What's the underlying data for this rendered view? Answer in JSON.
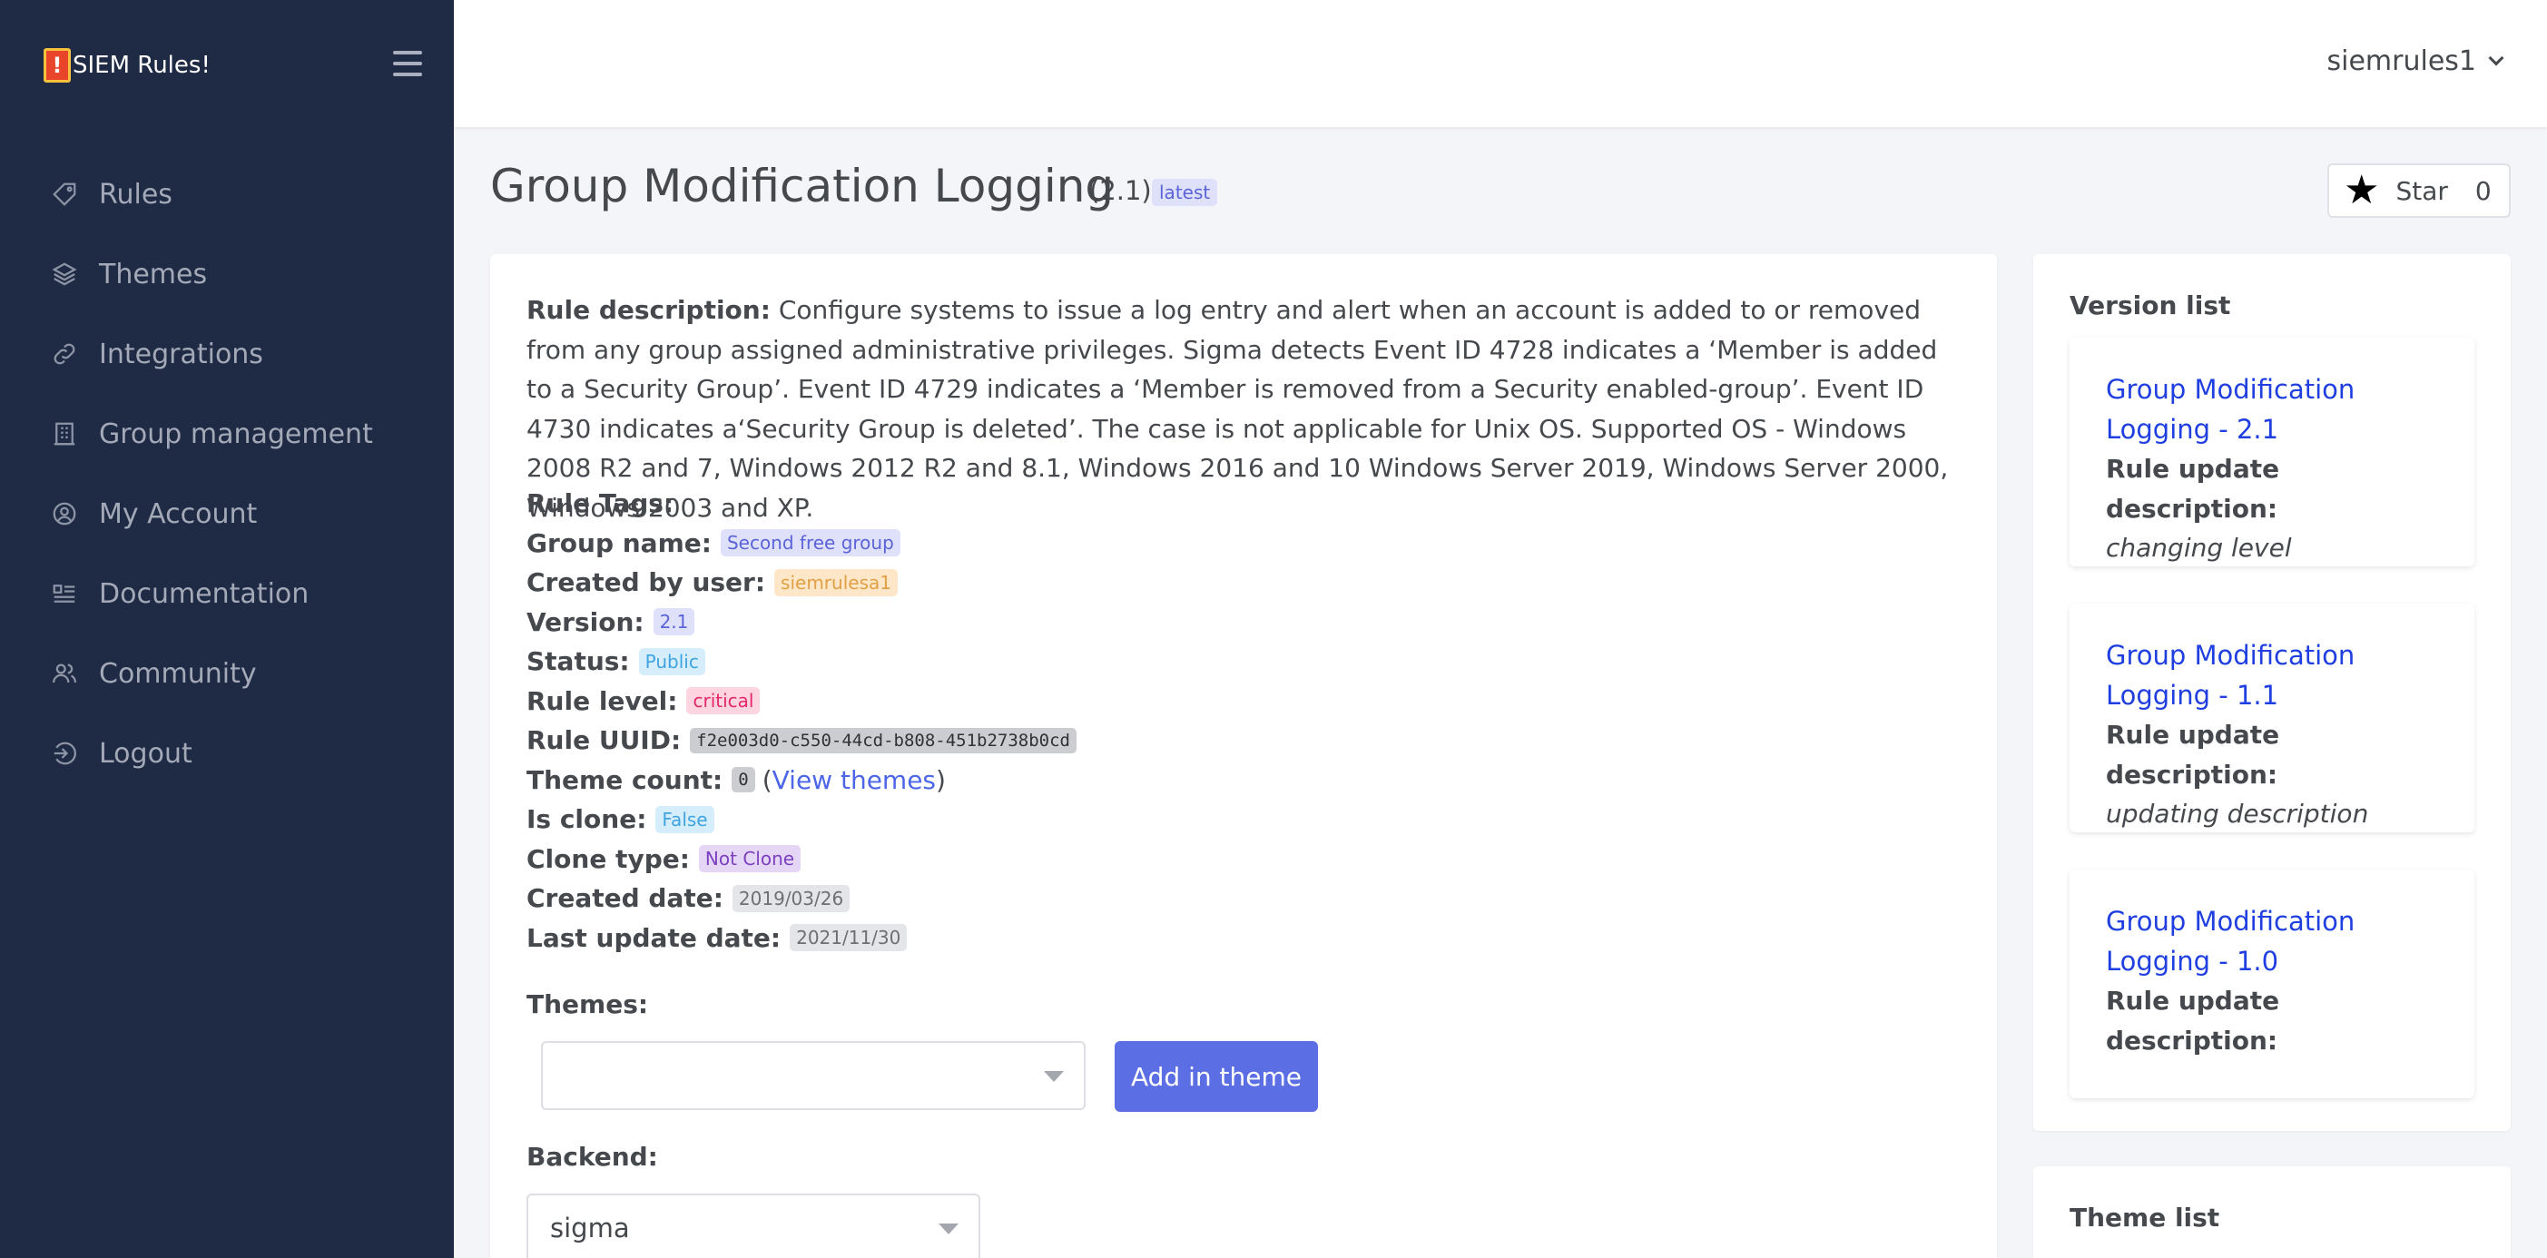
{
  "app": {
    "name": "SIEM Rules!"
  },
  "sidebar": {
    "items": [
      {
        "label": "Rules",
        "icon": "tag-icon"
      },
      {
        "label": "Themes",
        "icon": "layers-icon"
      },
      {
        "label": "Integrations",
        "icon": "link-icon"
      },
      {
        "label": "Group management",
        "icon": "building-icon"
      },
      {
        "label": "My Account",
        "icon": "user-circle-icon"
      },
      {
        "label": "Documentation",
        "icon": "document-list-icon"
      },
      {
        "label": "Community",
        "icon": "users-icon"
      },
      {
        "label": "Logout",
        "icon": "logout-icon"
      }
    ]
  },
  "header": {
    "user": "siemrules1"
  },
  "page": {
    "title": "Group Modification Logging",
    "version_paren": "(2.1)",
    "latest_badge": "latest",
    "star_label": "Star",
    "star_count": "0"
  },
  "rule": {
    "description_label": "Rule description:",
    "description": "Configure systems to issue a log entry and alert when an account is added to or removed from any group assigned administrative privileges. Sigma detects Event ID 4728 indicates a ‘Member is added to a Security Group’. Event ID 4729 indicates a ‘Member is removed from a Security enabled-group’. Event ID 4730 indicates a‘Security Group is deleted’. The case is not applicable for Unix OS. Supported OS - Windows 2008 R2 and 7, Windows 2012 R2 and 8.1, Windows 2016 and 10 Windows Server 2019, Windows Server 2000, Windows 2003 and XP.",
    "tags_label": "Rule Tags:",
    "group_label": "Group name:",
    "group": "Second free group",
    "created_by_label": "Created by user:",
    "created_by": "siemrulesa1",
    "version_label": "Version:",
    "version": "2.1",
    "status_label": "Status:",
    "status": "Public",
    "level_label": "Rule level:",
    "level": "critical",
    "uuid_label": "Rule UUID:",
    "uuid": "f2e003d0-c550-44cd-b808-451b2738b0cd",
    "theme_count_label": "Theme count:",
    "theme_count": "0",
    "view_themes_open": "(",
    "view_themes": "View themes",
    "view_themes_close": ")",
    "is_clone_label": "Is clone:",
    "is_clone": "False",
    "clone_type_label": "Clone type:",
    "clone_type": "Not Clone",
    "created_date_label": "Created date:",
    "created_date": "2019/03/26",
    "last_update_label": "Last update date:",
    "last_update": "2021/11/30"
  },
  "themes_form": {
    "label": "Themes:",
    "selected": "",
    "button": "Add in theme"
  },
  "backend_form": {
    "label": "Backend:",
    "selected": "sigma"
  },
  "version_list": {
    "title": "Version list",
    "items": [
      {
        "link": "Group Modification Logging - 2.1",
        "label": "Rule update description:",
        "text": "changing level"
      },
      {
        "link": "Group Modification Logging - 1.1",
        "label": "Rule update description:",
        "text": "updating description"
      },
      {
        "link": "Group Modification Logging - 1.0",
        "label": "Rule update description:",
        "text": ""
      }
    ]
  },
  "theme_list": {
    "title": "Theme list"
  }
}
